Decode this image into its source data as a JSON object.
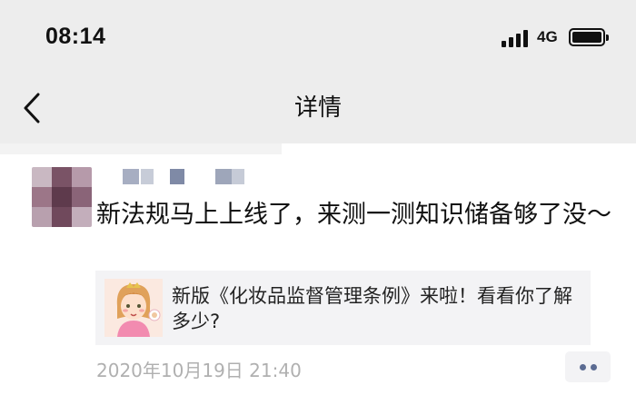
{
  "status_bar": {
    "time": "08:14",
    "network": "4G"
  },
  "nav": {
    "title": "详情",
    "back_icon": "chevron-left-icon"
  },
  "post": {
    "text": "新法规马上上线了，来测一测知识储备够了没～",
    "link_card": {
      "title": "新版《化妆品监督管理条例》来啦！看看你了解多少?"
    },
    "timestamp": "2020年10月19日 21:40",
    "more_icon": "more-dots-icon"
  },
  "colors": {
    "header_bg": "#ededed",
    "link_dots": "#5b6b92",
    "timestamp": "#b0b0b0"
  }
}
